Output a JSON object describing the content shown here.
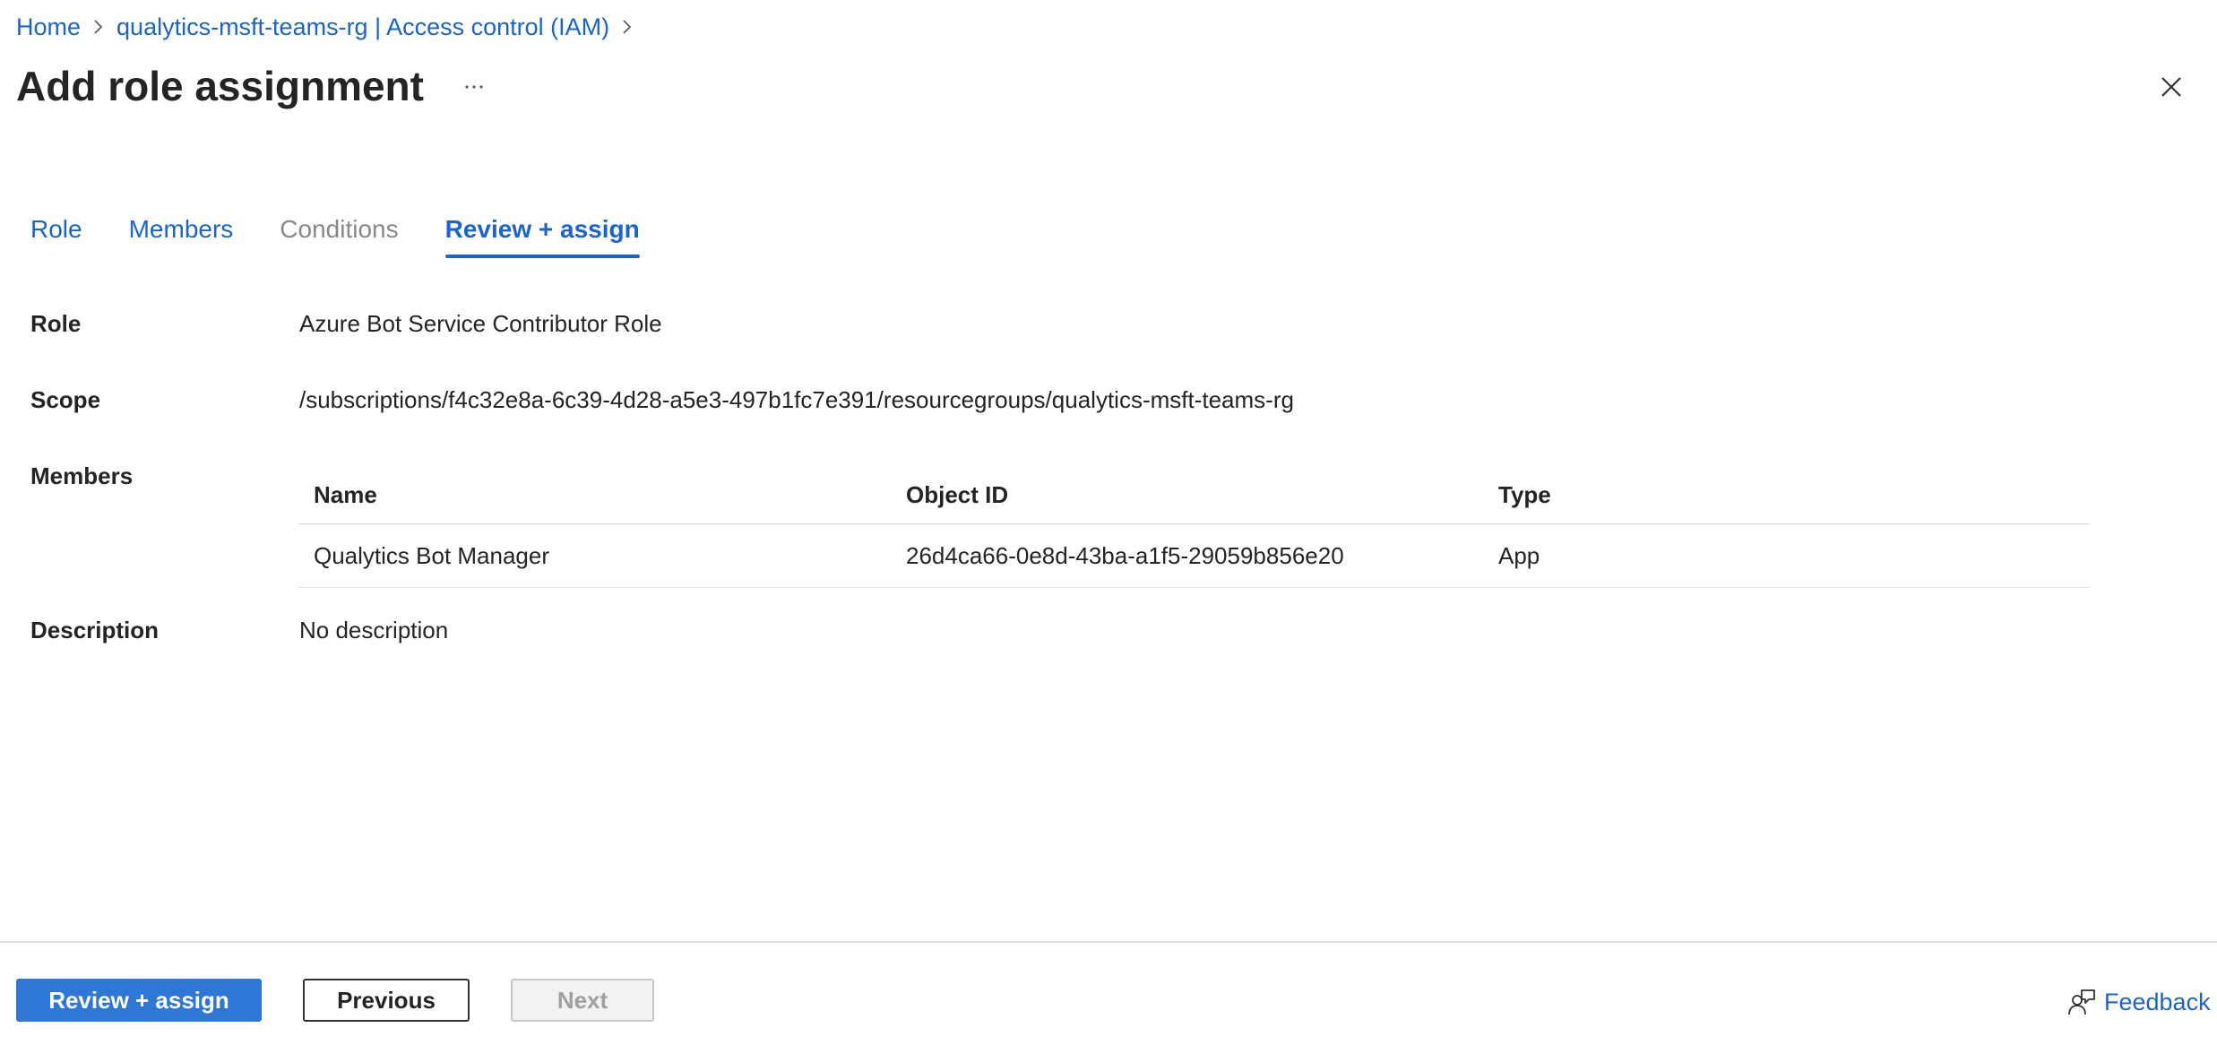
{
  "breadcrumb": {
    "items": [
      {
        "label": "Home"
      },
      {
        "label": "qualytics-msft-teams-rg | Access control (IAM)"
      }
    ]
  },
  "header": {
    "title": "Add role assignment",
    "more_label": "···"
  },
  "tabs": [
    {
      "label": "Role",
      "state": "enabled"
    },
    {
      "label": "Members",
      "state": "enabled"
    },
    {
      "label": "Conditions",
      "state": "disabled"
    },
    {
      "label": "Review + assign",
      "state": "selected"
    }
  ],
  "details": {
    "role_label": "Role",
    "role_value": "Azure Bot Service Contributor Role",
    "scope_label": "Scope",
    "scope_value": "/subscriptions/f4c32e8a-6c39-4d28-a5e3-497b1fc7e391/resourcegroups/qualytics-msft-teams-rg",
    "members_label": "Members",
    "description_label": "Description",
    "description_value": "No description"
  },
  "members_table": {
    "columns": [
      "Name",
      "Object ID",
      "Type"
    ],
    "rows": [
      [
        "Qualytics Bot Manager",
        "26d4ca66-0e8d-43ba-a1f5-29059b856e20",
        "App"
      ]
    ]
  },
  "footer": {
    "review_assign_label": "Review + assign",
    "previous_label": "Previous",
    "next_label": "Next",
    "feedback_label": "Feedback"
  },
  "icons": {
    "breadcrumb_separator": "chevron-right-icon",
    "close": "close-icon",
    "feedback": "feedback-icon"
  },
  "colors": {
    "accent": "#1b64c9",
    "primary_button": "#2f77d6",
    "disabled_text": "#8a8886"
  }
}
